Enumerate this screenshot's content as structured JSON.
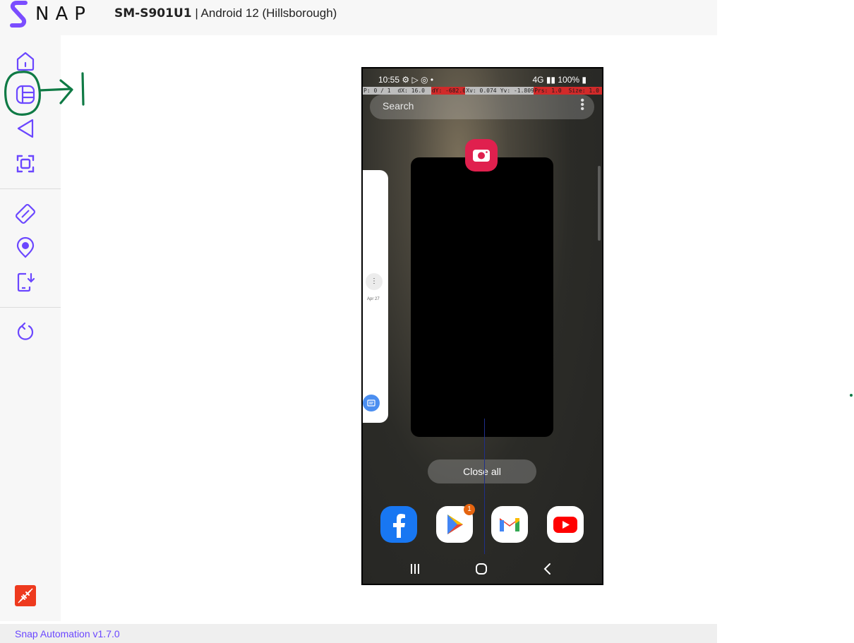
{
  "app": {
    "logo_text": "NAP",
    "device_model": "SM-S901U1",
    "device_separator": "|",
    "device_os": "Android 12 (Hillsborough)",
    "version": "Snap Automation v1.7.0",
    "accent_color": "#6b47ff"
  },
  "sidebar": {
    "items": [
      {
        "icon": "home-icon"
      },
      {
        "icon": "recent-apps-icon"
      },
      {
        "icon": "back-icon"
      },
      {
        "icon": "screenshot-icon"
      },
      {
        "icon": "rotate-icon"
      },
      {
        "icon": "location-icon"
      },
      {
        "icon": "install-app-icon"
      },
      {
        "icon": "refresh-icon"
      },
      {
        "icon": "disconnect-icon"
      }
    ]
  },
  "phone": {
    "status": {
      "time": "10:55",
      "network": "4G",
      "battery": "100%"
    },
    "overlay": [
      {
        "text": "P: 0 / 1",
        "color": "#bdbdbd"
      },
      {
        "text": "dX: 16.0",
        "color": "#bdbdbd"
      },
      {
        "text": "dY: -682.0",
        "color": "#d12a2a"
      },
      {
        "text": "Xv: 0.074",
        "color": "#bdbdbd"
      },
      {
        "text": "Yv: -1.809",
        "color": "#bdbdbd"
      },
      {
        "text": "Prs: 1.0",
        "color": "#d12a2a"
      },
      {
        "text": "Size: 1.0",
        "color": "#d12a2a"
      }
    ],
    "search_placeholder": "Search",
    "left_card_date": "Apr 27",
    "close_all": "Close all",
    "dock_badge": "1",
    "dock_apps": [
      "Facebook",
      "Play Store",
      "Gmail",
      "YouTube"
    ]
  }
}
